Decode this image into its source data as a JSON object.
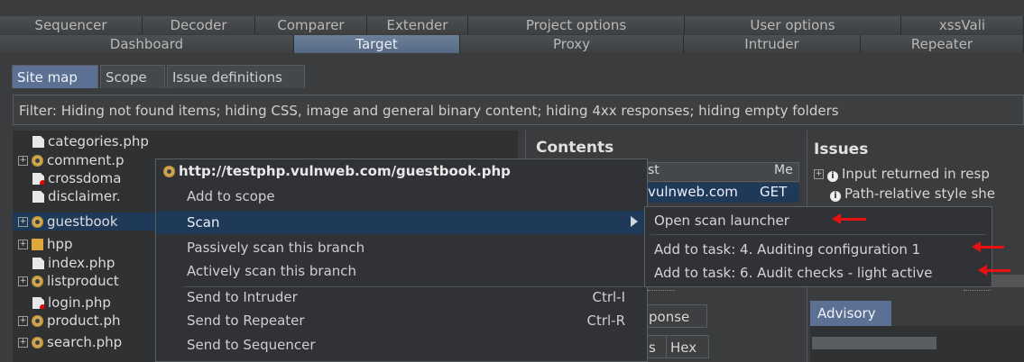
{
  "top_tabs_row1": [
    "Sequencer",
    "Decoder",
    "Comparer",
    "Extender",
    "Project options",
    "User options",
    "xssVali"
  ],
  "top_tabs_row2": [
    "Dashboard",
    "Target",
    "Proxy",
    "Intruder",
    "Repeater"
  ],
  "sub_tabs": [
    "Site map",
    "Scope",
    "Issue definitions"
  ],
  "filter_text": "Filter: Hiding not found items;  hiding CSS, image and general binary content;  hiding 4xx responses;  hiding empty folders",
  "tree_items": [
    "categories.php",
    "comment.p",
    "crossdoma",
    "disclaimer.",
    "guestbook",
    "hpp",
    "index.php",
    "listproduct",
    "login.php",
    "product.ph",
    "search.php"
  ],
  "contents": {
    "title": "Contents",
    "col_host": "st",
    "col_method": "Me",
    "row_host": "vulnweb.com",
    "row_method": "GET",
    "tab_response": "ponse",
    "tab_s": "s",
    "tab_hex": "Hex"
  },
  "issues": {
    "title": "Issues",
    "item1": "Input returned in resp",
    "item2": "Path-relative style she",
    "advisory_tab": "Advisory"
  },
  "context_menu": {
    "header": "http://testphp.vulnweb.com/guestbook.php",
    "add_scope": "Add to scope",
    "scan": "Scan",
    "passive": "Passively scan this branch",
    "active": "Actively scan this branch",
    "intruder": "Send to Intruder",
    "intruder_sc": "Ctrl-I",
    "repeater": "Send to Repeater",
    "repeater_sc": "Ctrl-R",
    "sequencer": "Send to Sequencer"
  },
  "scan_submenu": {
    "open_launcher": "Open scan launcher",
    "task4": "Add to task: 4. Auditing configuration 1",
    "task6": "Add to task: 6. Audit checks - light active"
  },
  "colors": {
    "accent": "#5c7094",
    "selection": "#1f3a58",
    "annotation_arrow": "#e81010"
  }
}
